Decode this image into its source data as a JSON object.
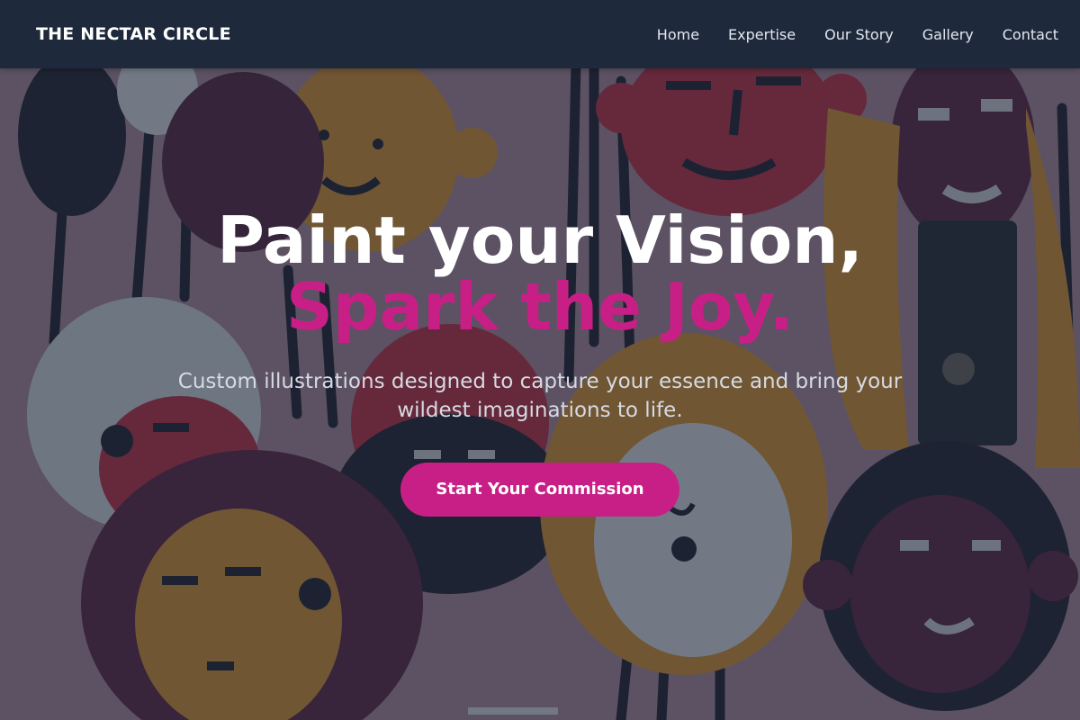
{
  "brand": {
    "name": "THE NECTAR CIRCLE"
  },
  "nav": {
    "items": [
      {
        "label": "Home"
      },
      {
        "label": "Expertise"
      },
      {
        "label": "Our Story"
      },
      {
        "label": "Gallery"
      },
      {
        "label": "Contact"
      }
    ]
  },
  "hero": {
    "headline_line1": "Paint your Vision,",
    "headline_line2": "Spark the Joy.",
    "subtitle": "Custom illustrations designed to capture your essence and bring your wildest imaginations to life.",
    "cta_label": "Start Your Commission",
    "background_image": "painted-faces-mural"
  },
  "colors": {
    "navbar": "#1e293b",
    "accent": "#c81f86",
    "text_light": "#ffffff"
  }
}
